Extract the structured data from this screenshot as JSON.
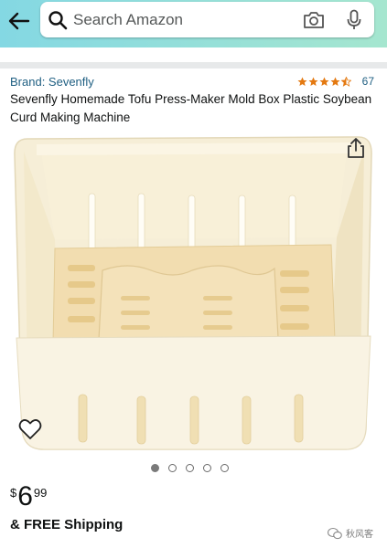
{
  "search": {
    "placeholder": "Search Amazon"
  },
  "product": {
    "brand": "Brand: Sevenfly",
    "rating": 4.5,
    "rating_count": "67",
    "title": "Sevenfly Homemade Tofu Press-Maker Mold Box Plastic Soybean Curd Making Machine",
    "image_count": 5,
    "active_image": 1,
    "image_name": "tofu-press-mold-box"
  },
  "price": {
    "currency": "$",
    "whole": "6",
    "fraction": "99"
  },
  "shipping": {
    "text": "& FREE Shipping"
  },
  "watermark": {
    "text": "秋风客"
  },
  "icons": {
    "back": "back-arrow-icon",
    "search": "search-icon",
    "camera": "camera-icon",
    "mic": "microphone-icon",
    "share": "share-icon",
    "heart": "heart-icon",
    "star": "star-icon"
  },
  "colors": {
    "topbar_start": "#84d8e3",
    "topbar_end": "#a5e6cf",
    "link": "#1f5f82",
    "star": "#e47911"
  }
}
